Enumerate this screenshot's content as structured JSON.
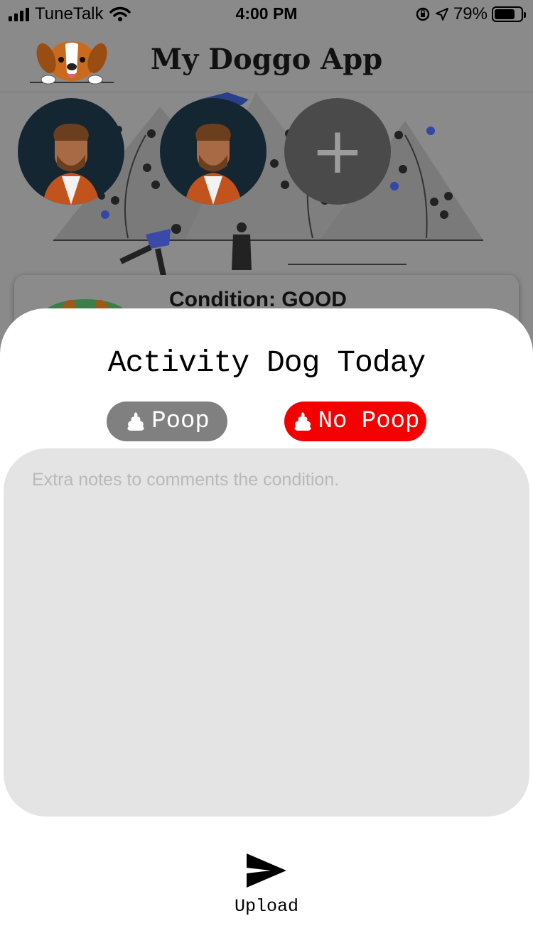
{
  "status_bar": {
    "carrier": "TuneTalk",
    "time": "4:00 PM",
    "battery": "79%",
    "battery_level": 0.79
  },
  "header": {
    "title": "My Doggo App",
    "logo_icon": "beagle-logo-icon"
  },
  "hero": {
    "add_profile_symbol": "+"
  },
  "card": {
    "condition": "Condition: GOOD"
  },
  "sheet": {
    "title": "Activity Dog Today",
    "poop_label": "Poop",
    "no_poop_label": "No Poop",
    "notes_placeholder": "Extra notes to comments the condition.",
    "notes_value": "",
    "upload_label": "Upload"
  },
  "colors": {
    "no_poop_active": "#f40000",
    "poop_inactive": "#808080",
    "notes_bg": "#e4e4e4",
    "overlay": "#8a8a8a"
  }
}
